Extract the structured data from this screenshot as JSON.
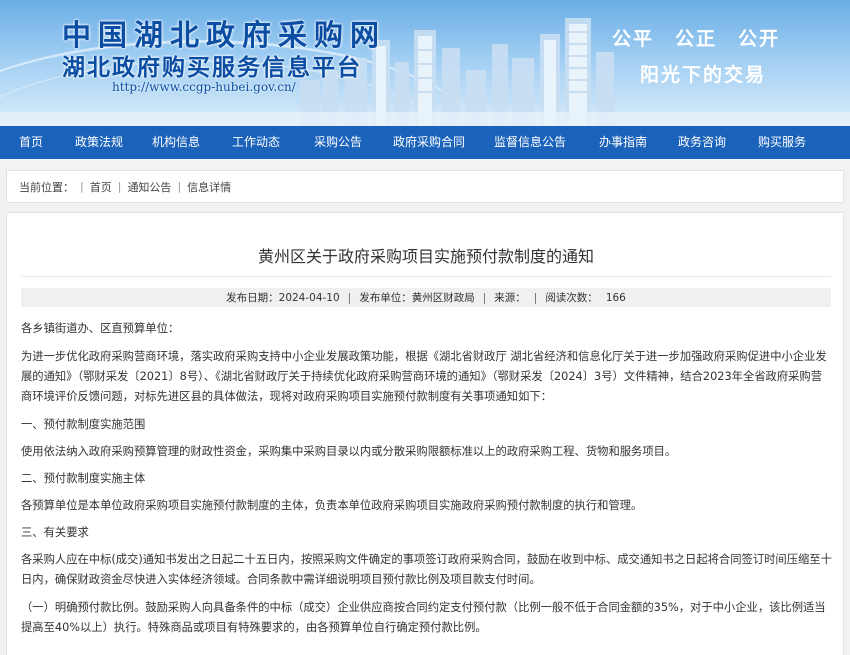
{
  "header": {
    "site_title": "中国湖北政府采购网",
    "site_subtitle": "湖北政府购买服务信息平台",
    "site_url": "http://www.ccgp-hubei.gov.cn/",
    "slogan_line1": "公平　公正　公开",
    "slogan_line2": "阳光下的交易"
  },
  "nav": {
    "items": [
      {
        "label": "首页"
      },
      {
        "label": "政策法规"
      },
      {
        "label": "机构信息"
      },
      {
        "label": "工作动态"
      },
      {
        "label": "采购公告"
      },
      {
        "label": "政府采购合同"
      },
      {
        "label": "监督信息公告"
      },
      {
        "label": "办事指南"
      },
      {
        "label": "政务咨询"
      },
      {
        "label": "购买服务"
      }
    ]
  },
  "breadcrumb": {
    "prefix": "当前位置：",
    "items": [
      "首页",
      "通知公告",
      "信息详情"
    ]
  },
  "article": {
    "title": "黄州区关于政府采购项目实施预付款制度的通知",
    "meta": {
      "publish_date_label": "发布日期：",
      "publish_date": "2024-04-10",
      "publisher_label": "发布单位：",
      "publisher": "黄州区财政局",
      "source_label": "来源：",
      "source": "",
      "views_label": "阅读次数：",
      "views": "166"
    },
    "paragraphs": [
      "各乡镇街道办、区直预算单位：",
      "为进一步优化政府采购营商环境，落实政府采购支持中小企业发展政策功能，根据《湖北省财政厅 湖北省经济和信息化厅关于进一步加强政府采购促进中小企业发展的通知》（鄂财采发〔2021〕8号）、《湖北省财政厅关于持续优化政府采购营商环境的通知》（鄂财采发〔2024〕3号）文件精神，结合2023年全省政府采购营商环境评价反馈问题，对标先进区县的具体做法，现将对政府采购项目实施预付款制度有关事项通知如下：",
      "一、预付款制度实施范围",
      "使用依法纳入政府采购预算管理的财政性资金，采购集中采购目录以内或分散采购限额标准以上的政府采购工程、货物和服务项目。",
      "二、预付款制度实施主体",
      "各预算单位是本单位政府采购项目实施预付款制度的主体，负责本单位政府采购项目实施政府采购预付款制度的执行和管理。",
      "三、有关要求",
      "各采购人应在中标(成交)通知书发出之日起二十五日内，按照采购文件确定的事项签订政府采购合同，鼓励在收到中标、成交通知书之日起将合同签订时间压缩至十日内，确保财政资金尽快进入实体经济领域。合同条款中需详细说明项目预付款比例及项目款支付时间。",
      "（一）明确预付款比例。鼓励采购人向具备条件的中标（成交）企业供应商按合同约定支付预付款（比例一般不低于合同金额的35%，对于中小企业，该比例适当提高至40%以上）执行。特殊商品或项目有特殊要求的，由各预算单位自行确定预付款比例。"
    ]
  },
  "colors": {
    "nav_bg": "#1a62ba",
    "title_blue": "#0b4da3",
    "page_bg": "#f2f2f2"
  }
}
